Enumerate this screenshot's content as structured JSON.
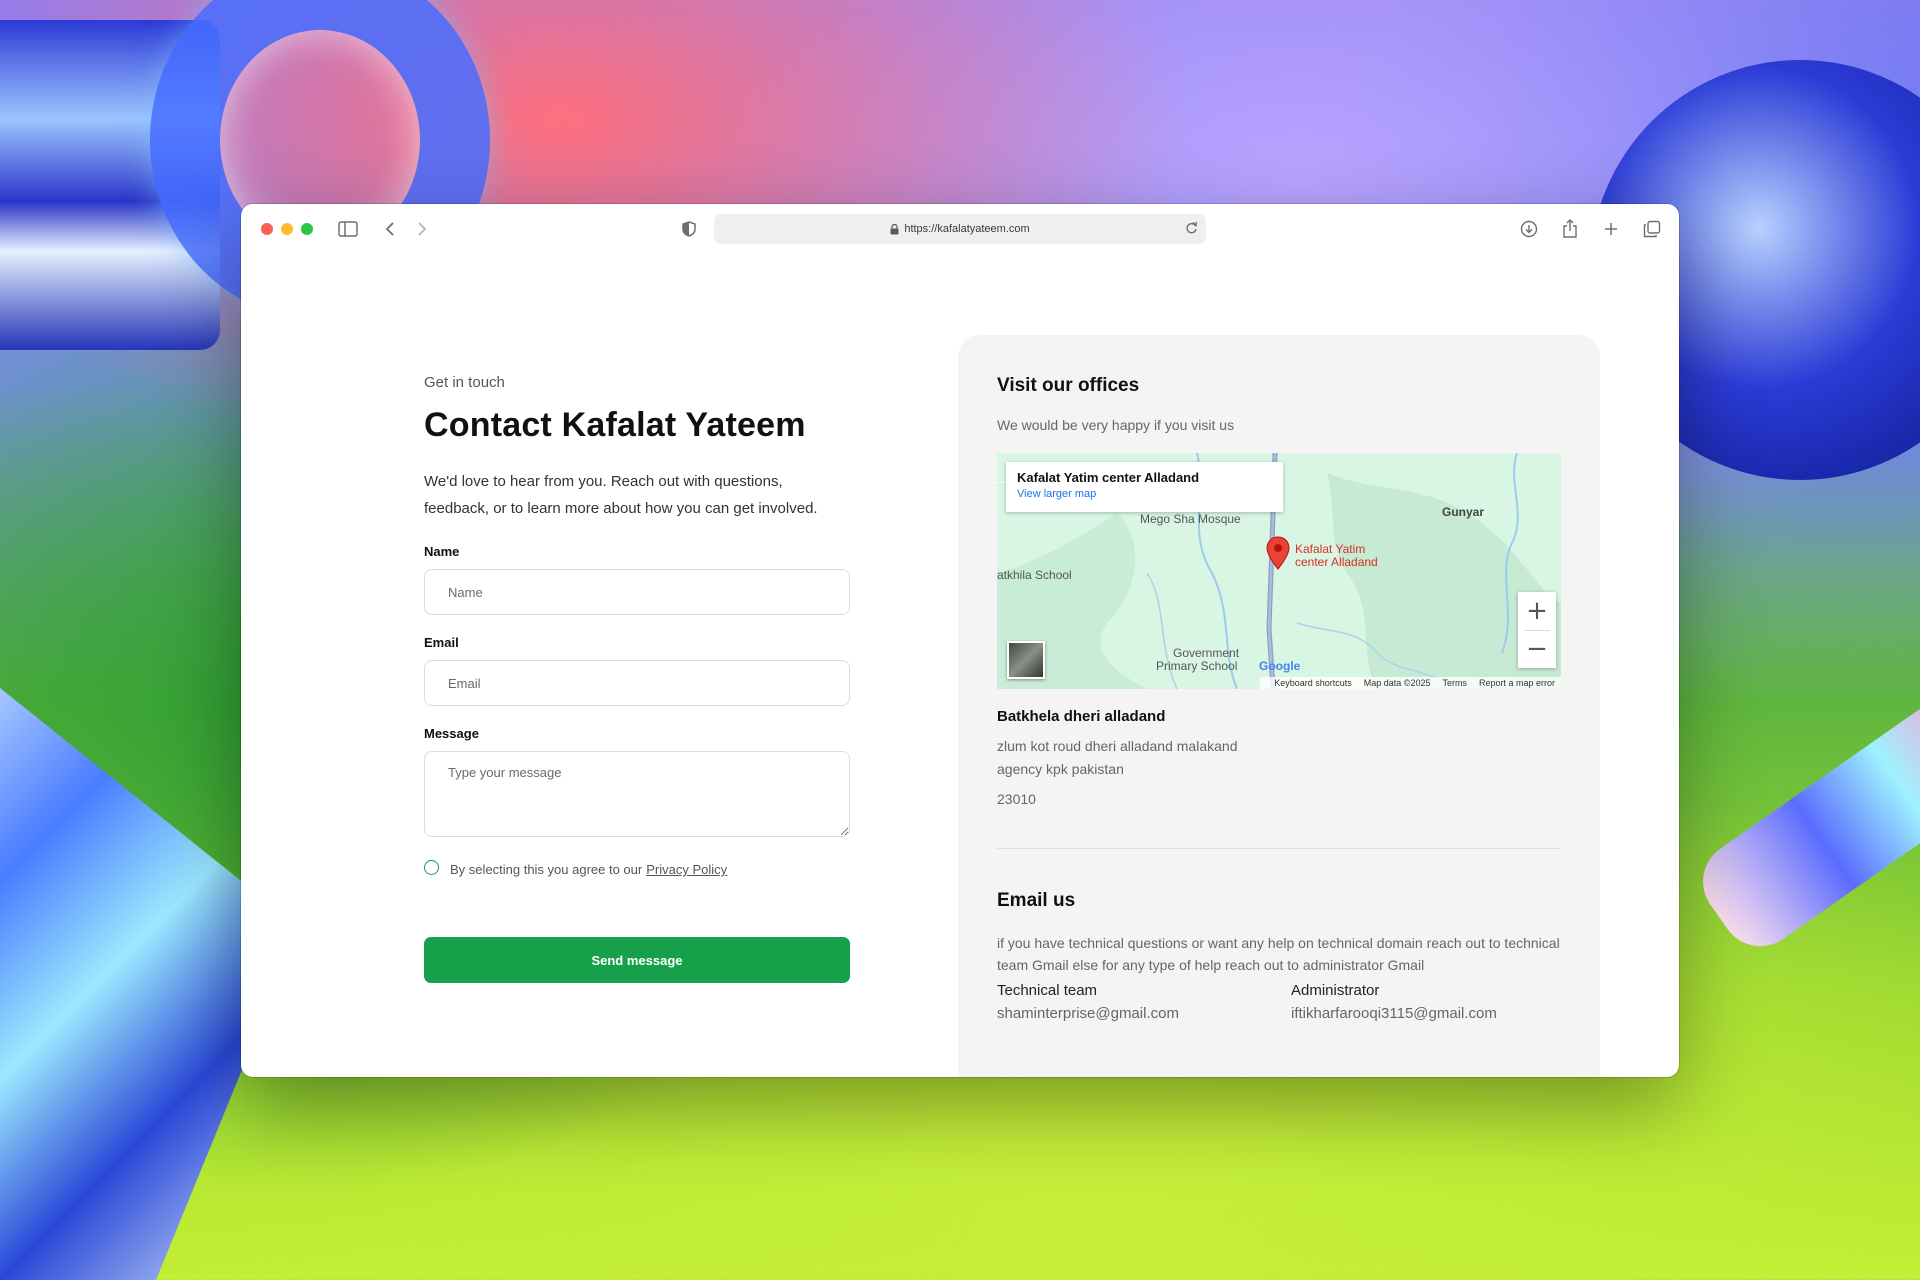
{
  "browser": {
    "url": "https://kafalatyateem.com"
  },
  "form": {
    "eyebrow": "Get in touch",
    "title": "Contact Kafalat Yateem",
    "intro": "We'd love to hear from you. Reach out with questions, feedback, or to learn more about how you can get involved.",
    "name_label": "Name",
    "name_placeholder": "Name",
    "email_label": "Email",
    "email_placeholder": "Email",
    "message_label": "Message",
    "message_placeholder": "Type your message",
    "agree_text": "By selecting this you agree to our",
    "privacy_link": "Privacy Policy",
    "submit_label": "Send message",
    "accent_color": "#16a04a"
  },
  "offices": {
    "title": "Visit our offices",
    "subtitle": "We would be very happy if you visit us",
    "map": {
      "place_name": "Kafalat Yatim center Alladand",
      "larger_map_link": "View larger map",
      "labels": {
        "mosque": "Mego Sha Mosque",
        "pin_line1": "Kafalat Yatim",
        "pin_line2": "center Alladand",
        "gunyar": "Gunyar",
        "school": "atkhila School",
        "gov1": "Government",
        "gov2": "Primary School"
      },
      "google_logo": "Google",
      "footer": [
        "Keyboard shortcuts",
        "Map data ©2025",
        "Terms",
        "Report a map error"
      ]
    },
    "address_title": "Batkhela dheri alladand",
    "address_line1": "zlum kot roud dheri alladand malakand",
    "address_line2": "agency kpk pakistan",
    "postcode": "23010"
  },
  "email": {
    "title": "Email us",
    "description": "if you have technical questions or want any help on technical domain reach out to technical team Gmail else for any type of help reach out to administrator Gmail",
    "contacts": [
      {
        "label": "Technical team",
        "value": "shaminterprise@gmail.com"
      },
      {
        "label": "Administrator",
        "value": "iftikharfarooqi3115@gmail.com"
      }
    ]
  }
}
